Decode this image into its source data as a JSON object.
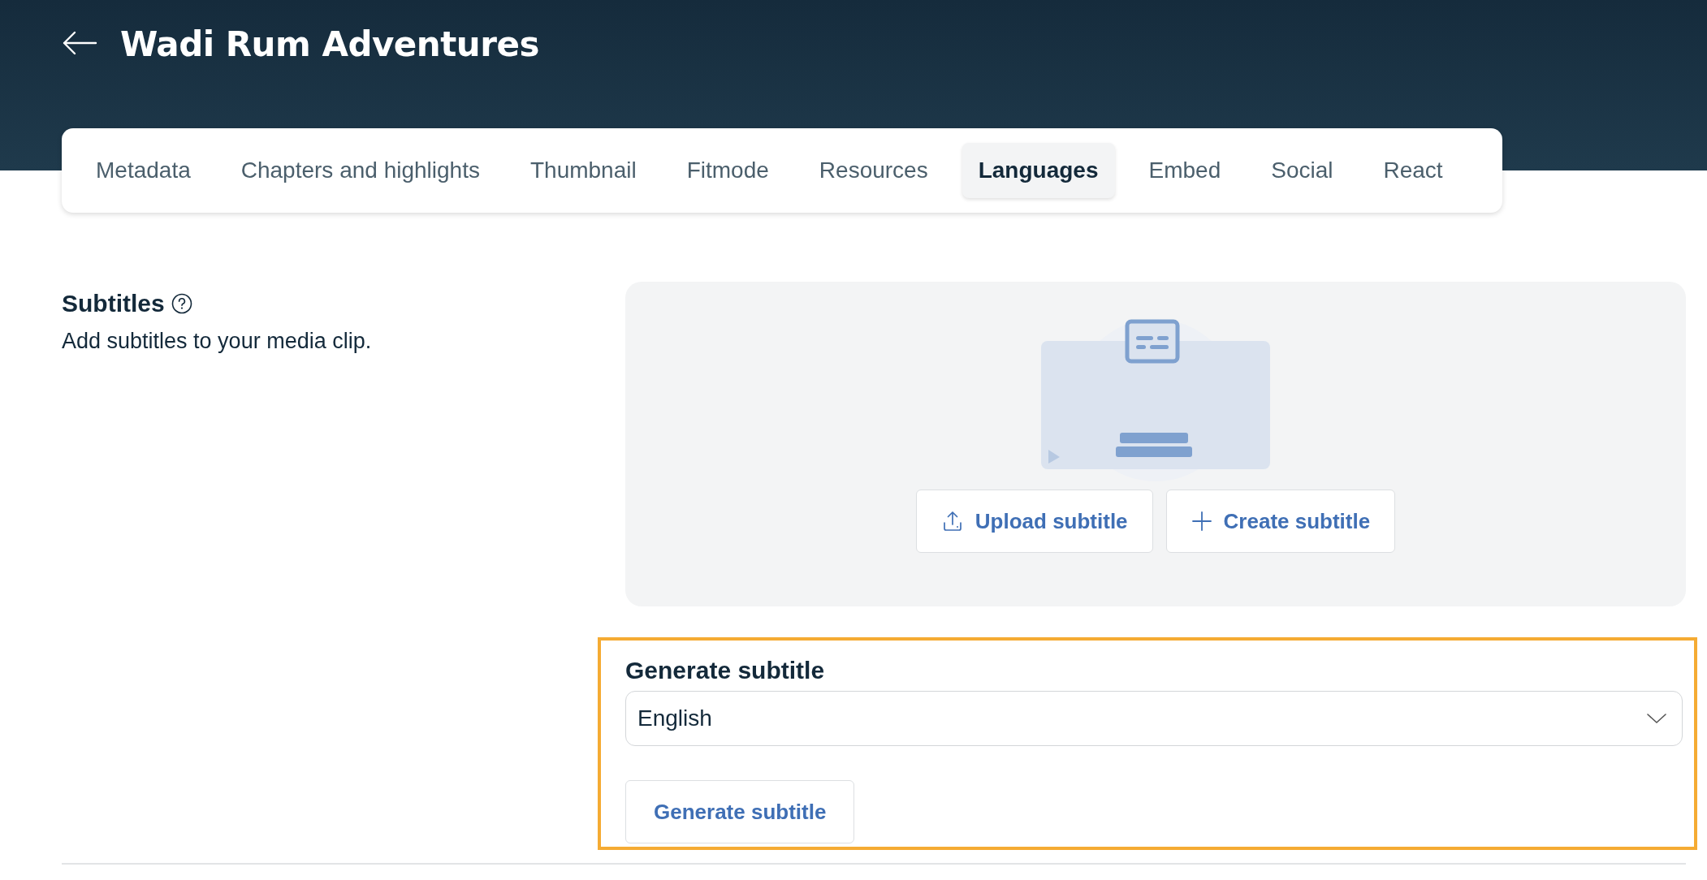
{
  "header": {
    "title": "Wadi Rum Adventures"
  },
  "tabs": [
    {
      "label": "Metadata",
      "selected": false
    },
    {
      "label": "Chapters and highlights",
      "selected": false
    },
    {
      "label": "Thumbnail",
      "selected": false
    },
    {
      "label": "Fitmode",
      "selected": false
    },
    {
      "label": "Resources",
      "selected": false
    },
    {
      "label": "Languages",
      "selected": true
    },
    {
      "label": "Embed",
      "selected": false
    },
    {
      "label": "Social",
      "selected": false
    },
    {
      "label": "React",
      "selected": false
    }
  ],
  "subtitles": {
    "heading": "Subtitles",
    "description": "Add subtitles to your media clip.",
    "upload_button": "Upload subtitle",
    "create_button": "Create subtitle"
  },
  "generate": {
    "heading": "Generate subtitle",
    "highlighted": true,
    "language_select": {
      "value": "English"
    },
    "button": "Generate subtitle"
  }
}
